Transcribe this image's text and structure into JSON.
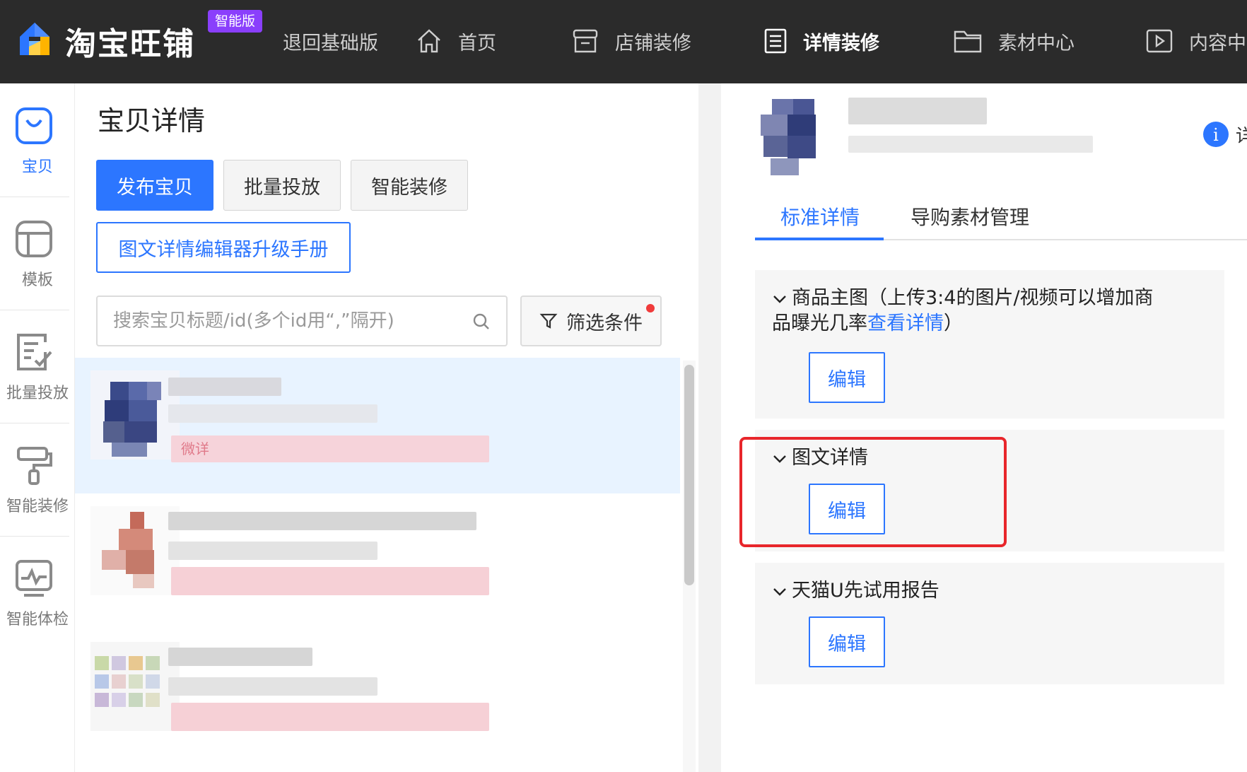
{
  "topbar": {
    "brand": "淘宝旺铺",
    "edition_badge": "智能版",
    "nav": [
      {
        "label": "退回基础版",
        "icon": ""
      },
      {
        "label": "首页",
        "icon": "home-icon"
      },
      {
        "label": "店铺装修",
        "icon": "store-icon"
      },
      {
        "label": "详情装修",
        "icon": "document-list-icon",
        "active": true
      },
      {
        "label": "素材中心",
        "icon": "folder-icon"
      },
      {
        "label": "内容中",
        "icon": "video-play-icon"
      }
    ]
  },
  "rail": {
    "items": [
      {
        "label": "宝贝",
        "icon": "bag-icon",
        "active": true
      },
      {
        "label": "模板",
        "icon": "template-icon"
      },
      {
        "label": "批量投放",
        "icon": "batch-edit-icon"
      },
      {
        "label": "智能装修",
        "icon": "paint-roller-icon"
      },
      {
        "label": "智能体检",
        "icon": "monitor-pulse-icon"
      }
    ]
  },
  "list_panel": {
    "title": "宝贝详情",
    "buttons": {
      "publish": "发布宝贝",
      "batch": "批量投放",
      "smart": "智能装修",
      "manual": "图文详情编辑器升级手册"
    },
    "search": {
      "placeholder": "搜索宝贝标题/id(多个id用“,”隔开)",
      "value": ""
    },
    "filter_label": "筛选条件",
    "first_item_tag": "微详"
  },
  "detail_panel": {
    "info_glyph": "i",
    "info_text": "详",
    "tabs": [
      {
        "label": "标准详情",
        "active": true
      },
      {
        "label": "导购素材管理"
      }
    ],
    "sections": [
      {
        "title": "商品主图（上传3:4的图片/视频可以增加商",
        "title_line2": "品曝光几率",
        "link": "查看详情",
        "title_end": "）",
        "edit_label": "编辑"
      },
      {
        "title": "图文详情",
        "edit_label": "编辑",
        "highlighted": true
      },
      {
        "title": "天猫U先试用报告",
        "edit_label": "编辑"
      }
    ]
  },
  "colors": {
    "accent": "#2c76ff",
    "topbar_bg": "#2b2b2b",
    "edition_badge": "#8a3ffc",
    "highlight": "#e8262b",
    "selected_row": "#e8f3ff"
  }
}
